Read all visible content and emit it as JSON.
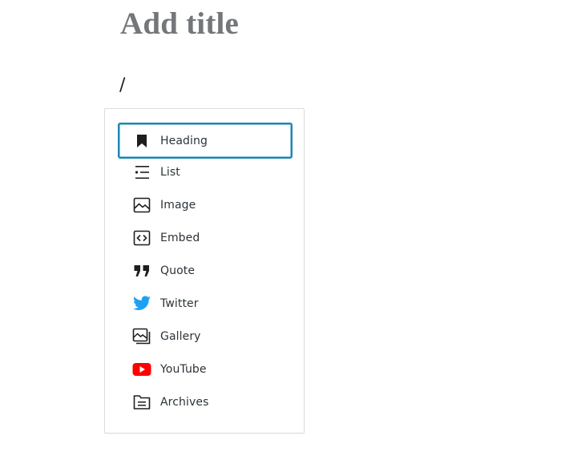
{
  "editor": {
    "title_placeholder": "Add title",
    "block_text": "/"
  },
  "inserter": {
    "selected_index": 0,
    "items": [
      {
        "label": "Heading",
        "icon": "bookmark-icon"
      },
      {
        "label": "List",
        "icon": "list-icon"
      },
      {
        "label": "Image",
        "icon": "image-icon"
      },
      {
        "label": "Embed",
        "icon": "embed-icon"
      },
      {
        "label": "Quote",
        "icon": "quote-icon"
      },
      {
        "label": "Twitter",
        "icon": "twitter-icon"
      },
      {
        "label": "Gallery",
        "icon": "gallery-icon"
      },
      {
        "label": "YouTube",
        "icon": "youtube-icon"
      },
      {
        "label": "Archives",
        "icon": "archives-icon"
      }
    ]
  },
  "colors": {
    "focus_border": "#1a86b6",
    "twitter_blue": "#1da1f2",
    "youtube_red": "#ff0000",
    "title_placeholder": "#74777a"
  }
}
